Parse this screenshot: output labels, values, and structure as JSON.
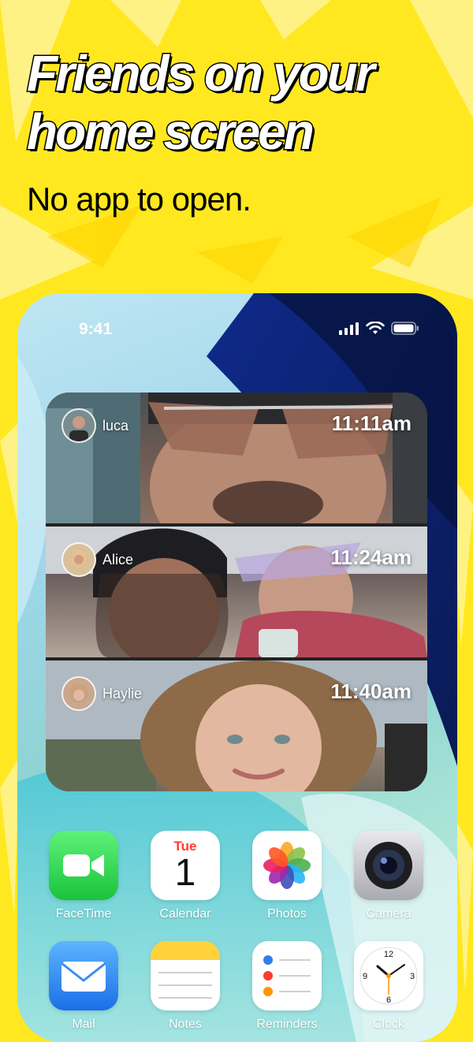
{
  "headline": {
    "line1": "Friends on your",
    "line2": "home screen"
  },
  "subheadline": "No app to open.",
  "colors": {
    "background": "#FFE81F",
    "headline_fill": "#FFFFFF",
    "headline_stroke": "#000000"
  },
  "phone": {
    "status_bar": {
      "time": "9:41",
      "icons": [
        "cellular-signal-icon",
        "wifi-icon",
        "battery-icon"
      ]
    },
    "widget": {
      "entries": [
        {
          "name": "luca",
          "time": "11:11am"
        },
        {
          "name": "Alice",
          "time": "11:24am"
        },
        {
          "name": "Haylie",
          "time": "11:40am"
        }
      ]
    },
    "apps": [
      {
        "label": "FaceTime",
        "icon": "facetime-icon"
      },
      {
        "label": "Calendar",
        "icon": "calendar-icon",
        "day": "Tue",
        "date": "1"
      },
      {
        "label": "Photos",
        "icon": "photos-icon"
      },
      {
        "label": "Camera",
        "icon": "camera-icon"
      },
      {
        "label": "Mail",
        "icon": "mail-icon"
      },
      {
        "label": "Notes",
        "icon": "notes-icon"
      },
      {
        "label": "Reminders",
        "icon": "reminders-icon"
      },
      {
        "label": "Clock",
        "icon": "clock-icon"
      }
    ]
  }
}
